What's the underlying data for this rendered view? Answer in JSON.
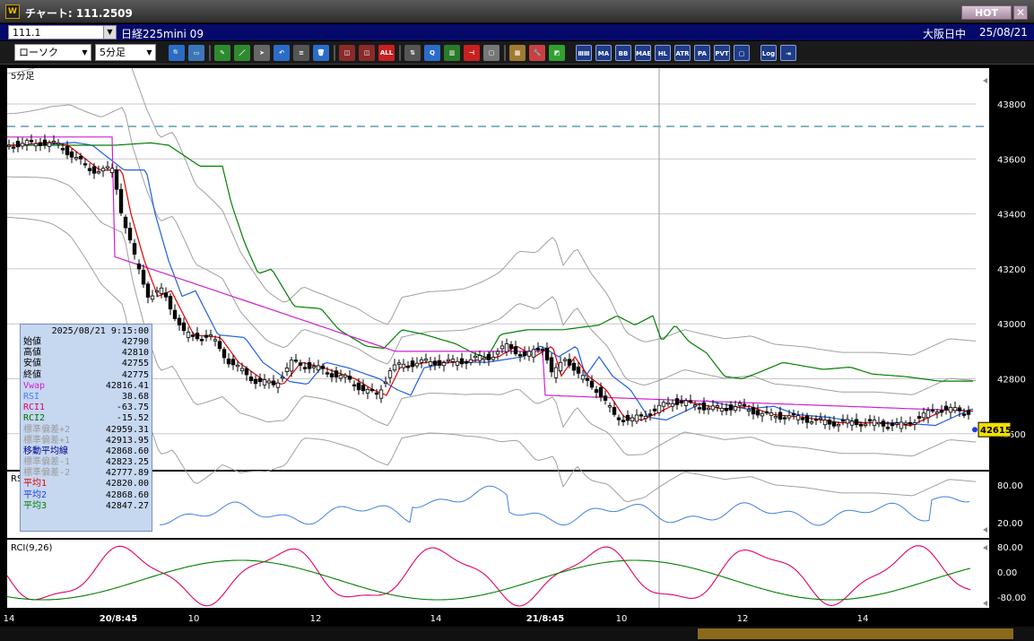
{
  "window": {
    "title": "チャート: 111.2509",
    "hot_label": "HOT",
    "close_label": "✕",
    "icon_label": "W"
  },
  "info": {
    "code": "111.1",
    "symbol": "日経225mini 09",
    "market": "大阪日中",
    "date": "25/08/21"
  },
  "toolbar": {
    "chart_type": "ローソク",
    "interval": "5分足",
    "buttons": [
      {
        "name": "zoom-icon",
        "label": "🔍",
        "color": "#2a6cc8"
      },
      {
        "name": "window-icon",
        "label": "▭",
        "color": "#3a77b8"
      },
      {
        "name": "pen-icon",
        "label": "✎",
        "color": "#2f8a2f"
      },
      {
        "name": "line-icon",
        "label": "／",
        "color": "#2f8a2f"
      },
      {
        "name": "cursor-icon",
        "label": "➤",
        "color": "#666"
      },
      {
        "name": "undo-icon",
        "label": "↶",
        "color": "#2a6cc8"
      },
      {
        "name": "list-icon",
        "label": "≡",
        "color": "#555"
      },
      {
        "name": "trash-icon",
        "label": "🗑",
        "color": "#2a6cc8"
      },
      {
        "name": "candle-icon",
        "label": "◫",
        "color": "#8a2a2a"
      },
      {
        "name": "candle-delete-icon",
        "label": "◫",
        "color": "#8a2a2a"
      },
      {
        "name": "all-icon",
        "label": "ALL",
        "color": "#c82020"
      },
      {
        "name": "up-down-icon",
        "label": "⇅",
        "color": "#555"
      },
      {
        "name": "search-chart-icon",
        "label": "Q",
        "color": "#2a6cc8"
      },
      {
        "name": "bar-chart-icon",
        "label": "▥",
        "color": "#2a7a2a"
      },
      {
        "name": "split-icon",
        "label": "⊣",
        "color": "#c82020"
      },
      {
        "name": "disabled-icon",
        "label": "▢",
        "color": "#777"
      },
      {
        "name": "pattern-icon",
        "label": "▦",
        "color": "#a07a30"
      },
      {
        "name": "wrench-icon",
        "label": "🔧",
        "color": "#c84040"
      },
      {
        "name": "palette-icon",
        "label": "◩",
        "color": "#30a030"
      }
    ],
    "indicators": [
      "ⅢⅢ",
      "MA",
      "BB",
      "MAE",
      "HL",
      "ATR",
      "PA",
      "PVT",
      "▢",
      "Log",
      "⇥"
    ]
  },
  "main_chart": {
    "interval_label": "5分足",
    "y_ticks": [
      "43800",
      "43600",
      "43400",
      "43200",
      "43000",
      "42800",
      "42600"
    ],
    "current_price": "42615"
  },
  "rsi_panel": {
    "label": "RSI",
    "y_ticks": [
      "80.00",
      "20.00"
    ]
  },
  "rci_panel": {
    "label": "RCI(9,26)",
    "y_ticks": [
      "80.00",
      "0.00",
      "-80.00"
    ]
  },
  "x_axis": {
    "labels": [
      "14",
      "20/8:45",
      "10",
      "12",
      "14",
      "21/8:45",
      "10",
      "12",
      "14"
    ]
  },
  "legend": {
    "header": "2025/08/21 9:15:00",
    "rows": [
      {
        "label": "始値",
        "value": "42790",
        "color": "#000000"
      },
      {
        "label": "高値",
        "value": "42810",
        "color": "#000000"
      },
      {
        "label": "安値",
        "value": "42755",
        "color": "#000000"
      },
      {
        "label": "終値",
        "value": "42775",
        "color": "#000000"
      },
      {
        "label": "Vwap",
        "value": "42816.41",
        "color": "#d020d0"
      },
      {
        "label": "RSI",
        "value": "38.68",
        "color": "#4080ff"
      },
      {
        "label": "RCI1",
        "value": "-63.75",
        "color": "#e0006a"
      },
      {
        "label": "RCI2",
        "value": "-15.52",
        "color": "#007000"
      },
      {
        "label": "標準偏差+2",
        "value": "42959.31",
        "color": "#9a9a9a"
      },
      {
        "label": "標準偏差+1",
        "value": "42913.95",
        "color": "#9a9a9a"
      },
      {
        "label": "移動平均線",
        "value": "42868.60",
        "color": "#00008a"
      },
      {
        "label": "標準偏差-1",
        "value": "42823.25",
        "color": "#9a9a9a"
      },
      {
        "label": "標準偏差-2",
        "value": "42777.89",
        "color": "#9a9a9a"
      },
      {
        "label": "平均1",
        "value": "42820.00",
        "color": "#e00000"
      },
      {
        "label": "平均2",
        "value": "42868.60",
        "color": "#2040e0"
      },
      {
        "label": "平均3",
        "value": "42847.27",
        "color": "#008000"
      }
    ]
  },
  "colors": {
    "ma1": "#e00000",
    "ma2": "#2060e0",
    "ma3": "#008000",
    "vwap": "#d020d0",
    "band": "#a0a0a0",
    "rsi": "#4080e0",
    "rci1": "#e0006a",
    "rci2": "#008000",
    "price_tag": "#f0e000"
  }
}
